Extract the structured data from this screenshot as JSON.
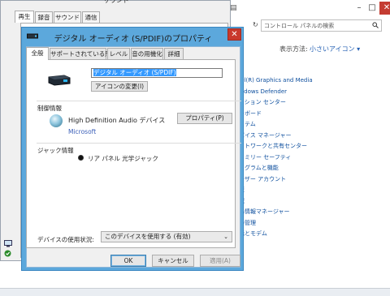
{
  "control_panel": {
    "titlebar_icon": "▤",
    "minimize": "–",
    "maximize": "□",
    "close": "✕",
    "refresh": "↻",
    "search_placeholder": "コントロール パネルの検索",
    "search_icon": "search-icon",
    "view_by_label": "表示方法:",
    "view_by_value": "小さいアイコン ▾",
    "items": [
      "Intel(R) Graphics and Media",
      "Windows Defender",
      "アクション センター",
      "キーボード",
      "システム",
      "デバイス マネージャー",
      "ネットワークと共有センター",
      "ファミリー セーフティ",
      "プログラムと機能",
      "ユーザー アカウント",
      "回復",
      "地域",
      "資格情報マネージャー",
      "色の管理",
      "電話とモデム"
    ]
  },
  "sound_window": {
    "title": "サウンド",
    "tabs": [
      "再生",
      "録音",
      "サウンド",
      "通信"
    ],
    "selected_tab": "再生"
  },
  "dialog": {
    "title": "デジタル オーディオ (S/PDIF)のプロパティ",
    "close": "✕",
    "tabs": [
      "全般",
      "サポートされている形式",
      "レベル",
      "音の用機化",
      "詳細"
    ],
    "selected_tab": "全般",
    "device_name_value": "デジタル オーディオ (S/PDIF)",
    "change_icon_button": "アイコンの変更(I)",
    "controller_info_heading": "制御情報",
    "controller_name": "High Definition Audio デバイス",
    "controller_vendor": "Microsoft",
    "controller_properties_button": "プロパティ(P)",
    "jack_info_heading": "ジャック情報",
    "jack_description": "リア パネル 光学ジャック",
    "usage_label": "デバイスの使用状況:",
    "usage_value": "このデバイスを使用する (有効)",
    "ok_button": "OK",
    "cancel_button": "キャンセル",
    "apply_button": "適用(A)"
  }
}
